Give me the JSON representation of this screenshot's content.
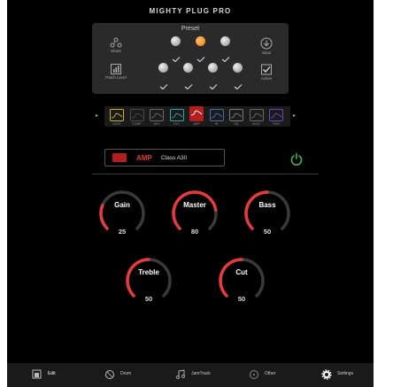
{
  "app": {
    "title": "MIGHTY PLUG PRO"
  },
  "preset": {
    "label": "Preset",
    "share_label": "Share",
    "save_label": "Save",
    "patch_level_label": "Patch Level",
    "active_label": "Active",
    "top_row": [
      {
        "name": "preset-1",
        "active": false
      },
      {
        "name": "preset-2",
        "active": true
      },
      {
        "name": "preset-3",
        "active": false
      }
    ],
    "bottom_row": [
      {
        "name": "preset-4",
        "active": false
      },
      {
        "name": "preset-5",
        "active": false
      },
      {
        "name": "preset-6",
        "active": false
      },
      {
        "name": "preset-7",
        "active": false
      }
    ]
  },
  "signal_chain": [
    {
      "label": "GATE",
      "color": "#c8b33a"
    },
    {
      "label": "COMP",
      "color": "#4a4a4a"
    },
    {
      "label": "EFX",
      "color": "#6a6a6a"
    },
    {
      "label": "DLY",
      "color": "#3fa3a0"
    },
    {
      "label": "AMP",
      "color": "#b51e1e"
    },
    {
      "label": "IR",
      "color": "#3f6fb0"
    },
    {
      "label": "EQ",
      "color": "#7a7a7a"
    },
    {
      "label": "MOD",
      "color": "#6a6a6a"
    },
    {
      "label": "RVB",
      "color": "#6b48b5"
    }
  ],
  "amp": {
    "name": "AMP",
    "model": "Class A30",
    "power_icon": "power-icon",
    "power_on": true,
    "accent_color": "#e83a3a",
    "power_color": "#3fb950"
  },
  "knobs": [
    {
      "name": "Gain",
      "value": "25",
      "level": 0.25
    },
    {
      "name": "Master",
      "value": "80",
      "level": 0.8
    },
    {
      "name": "Bass",
      "value": "50",
      "level": 0.5
    },
    {
      "name": "Treble",
      "value": "50",
      "level": 0.5
    },
    {
      "name": "Cut",
      "value": "50",
      "level": 0.5
    }
  ],
  "tabs": [
    {
      "label": "Edit",
      "icon": "edit-icon",
      "active": true
    },
    {
      "label": "Drum",
      "icon": "drum-icon",
      "active": false
    },
    {
      "label": "JamTrack",
      "icon": "jamtrack-icon",
      "active": false
    },
    {
      "label": "Other",
      "icon": "other-icon",
      "active": false
    },
    {
      "label": "Settings",
      "icon": "gear-icon",
      "active": false
    }
  ]
}
